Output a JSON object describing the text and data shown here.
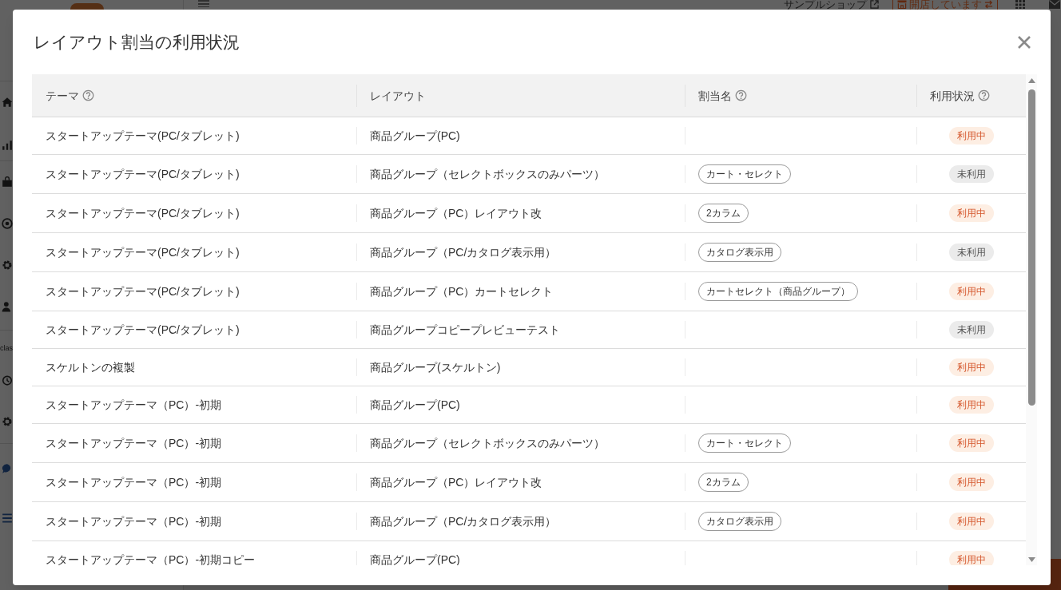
{
  "background": {
    "shop_link": "サンプルショップ",
    "store_status": "開店しています",
    "sidebar_label": "clas"
  },
  "dialog": {
    "title": "レイアウト割当の利用状況",
    "table": {
      "columns": [
        {
          "label": "テーマ",
          "help": true
        },
        {
          "label": "レイアウト",
          "help": false
        },
        {
          "label": "割当名",
          "help": true
        },
        {
          "label": "利用状況",
          "help": true
        }
      ],
      "rows": [
        {
          "theme": "スタートアップテーマ(PC/タブレット)",
          "layout": "商品グループ(PC)",
          "status": {
            "label": "利用中",
            "kind": "in_use"
          }
        },
        {
          "theme": "スタートアップテーマ(PC/タブレット)",
          "layout": "商品グループ（セレクトボックスのみパーツ）",
          "assignment": "カート・セレクト",
          "status": {
            "label": "未利用",
            "kind": "unused"
          }
        },
        {
          "theme": "スタートアップテーマ(PC/タブレット)",
          "layout": "商品グループ（PC）レイアウト改",
          "assignment": "2カラム",
          "status": {
            "label": "利用中",
            "kind": "in_use"
          }
        },
        {
          "theme": "スタートアップテーマ(PC/タブレット)",
          "layout": "商品グループ（PC/カタログ表示用）",
          "assignment": "カタログ表示用",
          "status": {
            "label": "未利用",
            "kind": "unused"
          }
        },
        {
          "theme": "スタートアップテーマ(PC/タブレット)",
          "layout": "商品グループ（PC）カートセレクト",
          "assignment": "カートセレクト（商品グループ）",
          "status": {
            "label": "利用中",
            "kind": "in_use"
          }
        },
        {
          "theme": "スタートアップテーマ(PC/タブレット)",
          "layout": "商品グループコピープレビューテスト",
          "status": {
            "label": "未利用",
            "kind": "unused"
          }
        },
        {
          "theme": "スケルトンの複製",
          "layout": "商品グループ(スケルトン)",
          "status": {
            "label": "利用中",
            "kind": "in_use"
          }
        },
        {
          "theme": "スタートアップテーマ（PC）-初期",
          "layout": "商品グループ(PC)",
          "status": {
            "label": "利用中",
            "kind": "in_use"
          }
        },
        {
          "theme": "スタートアップテーマ（PC）-初期",
          "layout": "商品グループ（セレクトボックスのみパーツ）",
          "assignment": "カート・セレクト",
          "status": {
            "label": "利用中",
            "kind": "in_use"
          }
        },
        {
          "theme": "スタートアップテーマ（PC）-初期",
          "layout": "商品グループ（PC）レイアウト改",
          "assignment": "2カラム",
          "status": {
            "label": "利用中",
            "kind": "in_use"
          }
        },
        {
          "theme": "スタートアップテーマ（PC）-初期",
          "layout": "商品グループ（PC/カタログ表示用）",
          "assignment": "カタログ表示用",
          "status": {
            "label": "利用中",
            "kind": "in_use"
          }
        },
        {
          "theme": "スタートアップテーマ（PC）-初期コピー",
          "layout": "商品グループ(PC)",
          "status": {
            "label": "利用中",
            "kind": "in_use"
          }
        }
      ]
    }
  }
}
